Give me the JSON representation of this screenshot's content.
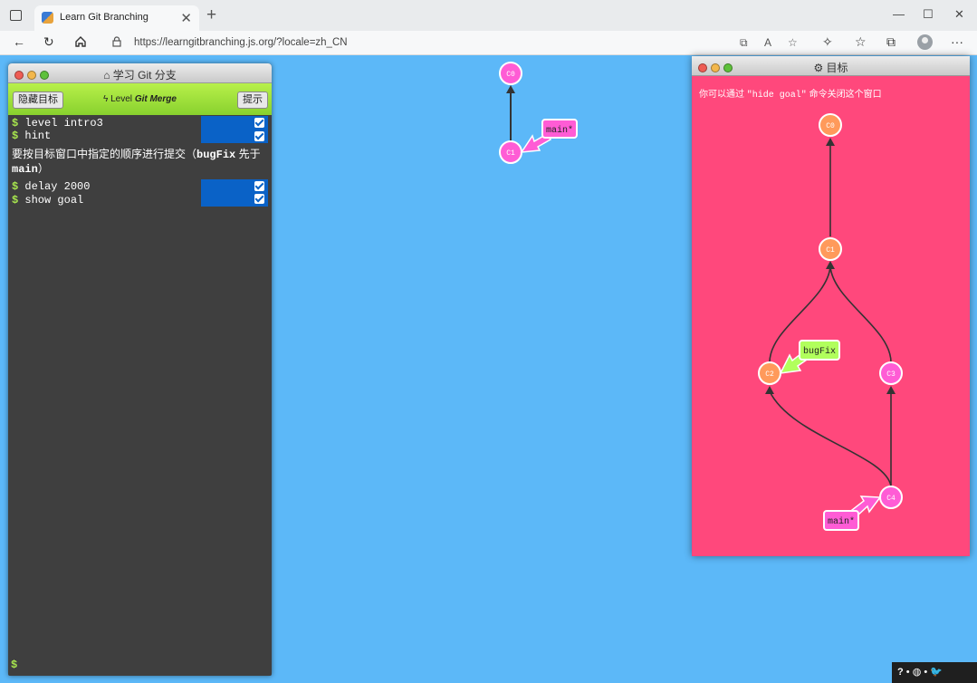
{
  "browser": {
    "tab_title": "Learn Git Branching",
    "url": "https://learngitbranching.js.org/?locale=zh_CN",
    "new_tab": "+",
    "tab_close": "✕",
    "window_controls": [
      "—",
      "☐",
      "✕"
    ]
  },
  "terminal": {
    "title": "学习 Git 分支",
    "title_icon": "home-icon",
    "hide_goal_button": "隐藏目标",
    "hint_button": "提示",
    "level_prefix": "Level",
    "level_name": "Git Merge",
    "commands": [
      {
        "prompt": "$",
        "text": "level intro3",
        "done": true
      },
      {
        "prompt": "$",
        "text": "hint",
        "done": true
      },
      {
        "prompt": "$",
        "text": "delay 2000",
        "done": true
      },
      {
        "prompt": "$",
        "text": "show goal",
        "done": true
      }
    ],
    "hint_text_before": "要按目标窗口中指定的顺序进行提交（",
    "hint_code_1": "bugFix",
    "hint_text_middle": " 先于 ",
    "hint_code_2": "main",
    "hint_text_after": "）",
    "input_prompt": "$"
  },
  "goal_window": {
    "title": "目标",
    "title_icon": "gear-icon",
    "hint_before": "你可以通过 ",
    "hint_code": "\"hide goal\"",
    "hint_after": " 命令关闭这个窗口"
  },
  "main_tree": {
    "commits": [
      "C0",
      "C1"
    ],
    "branch": "main*",
    "colors": {
      "commit": "#ff5cd5",
      "branch_arrow": "#ff5cd5",
      "stroke": "#ffffff"
    }
  },
  "goal_tree": {
    "commits": [
      "C0",
      "C1",
      "C2",
      "C3",
      "C4"
    ],
    "branches": [
      "bugFix",
      "main*"
    ],
    "colors": {
      "orange_commit": "#ff9a5b",
      "pink_commit": "#ff5cd5",
      "bugfix_arrow": "#b1ff5c",
      "main_arrow": "#ff5cd5"
    }
  },
  "social_bar": {
    "help": "?",
    "globe": "globe-icon",
    "twitter": "twitter-icon"
  }
}
